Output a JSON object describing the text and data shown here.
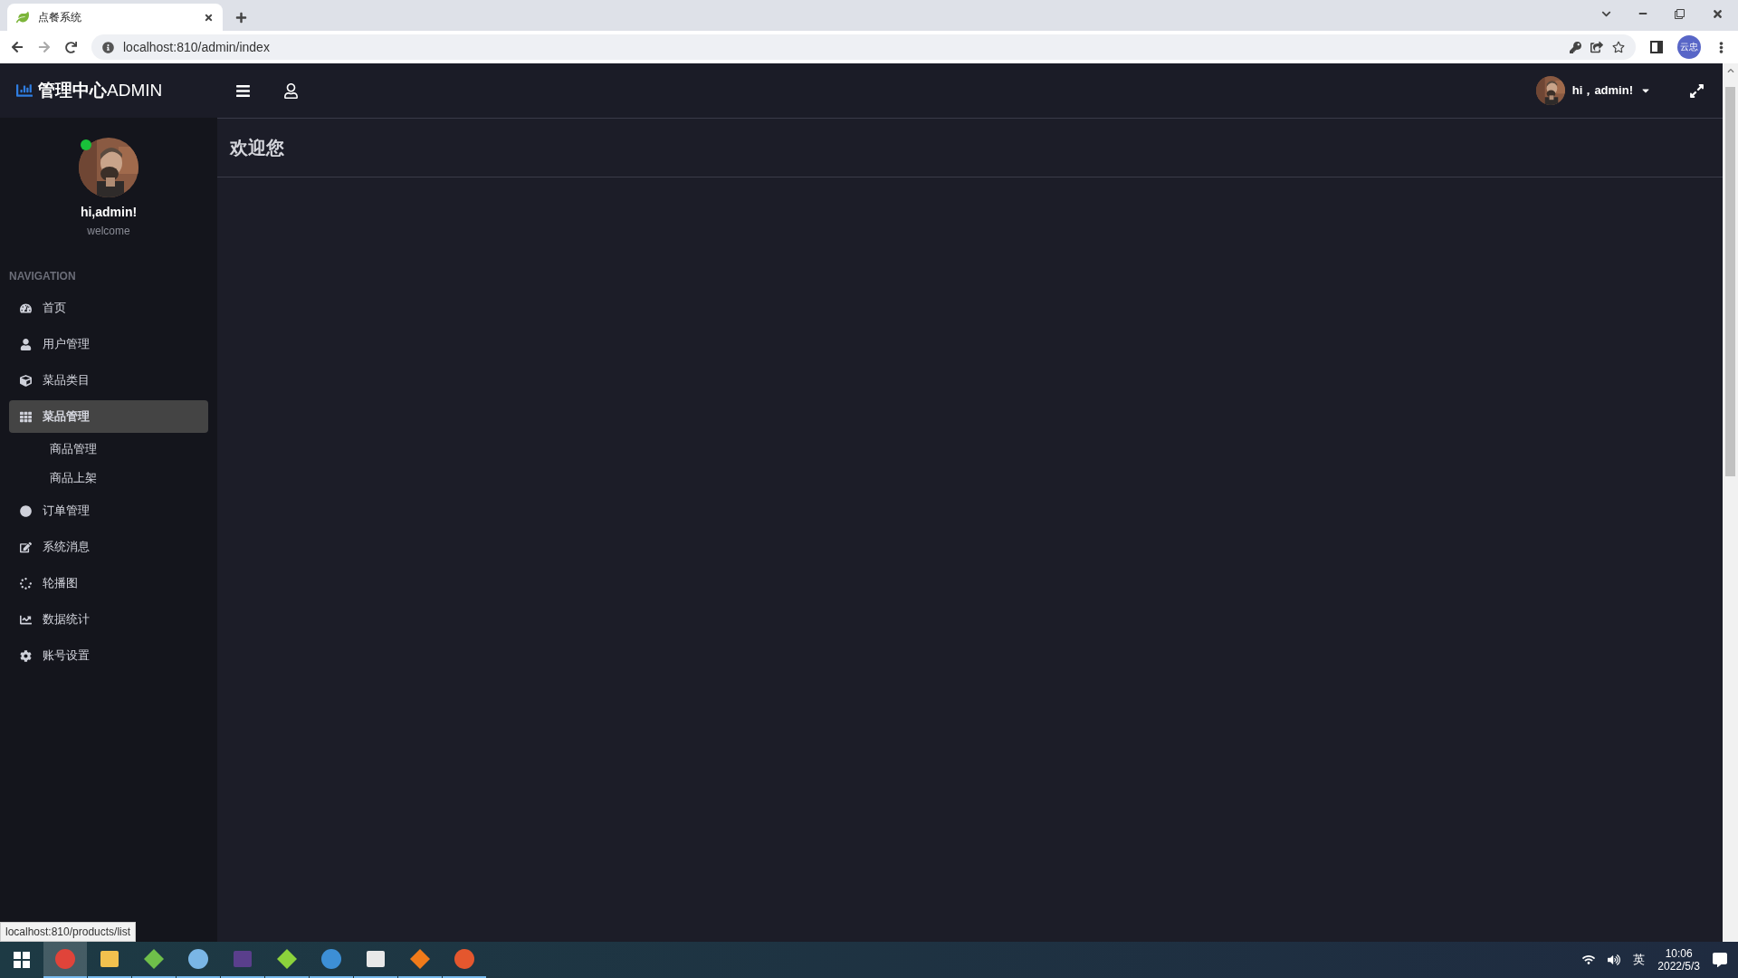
{
  "browser": {
    "tab_title": "点餐系统",
    "url": "localhost:810/admin/index",
    "profile_badge": "云忠",
    "status_url": "localhost:810/products/list"
  },
  "header": {
    "brand_bold": "管理中心",
    "brand_rest": "ADMIN",
    "user_menu": "hi，admin!"
  },
  "profile": {
    "name": "hi,admin!",
    "subtitle": "welcome",
    "online": true
  },
  "navigation": {
    "heading": "NAVIGATION",
    "items": [
      {
        "label": "首页",
        "selected": false
      },
      {
        "label": "用户管理",
        "selected": false
      },
      {
        "label": "菜品类目",
        "selected": false
      },
      {
        "label": "菜品管理",
        "selected": true,
        "expanded": true,
        "children": [
          {
            "label": "商品管理",
            "selected": false
          },
          {
            "label": "商品上架",
            "selected": false
          }
        ]
      },
      {
        "label": "订单管理",
        "selected": false
      },
      {
        "label": "系统消息",
        "selected": false
      },
      {
        "label": "轮播图",
        "selected": false
      },
      {
        "label": "数据统计",
        "selected": false
      },
      {
        "label": "账号设置",
        "selected": false
      }
    ]
  },
  "page": {
    "title": "欢迎您"
  },
  "taskbar": {
    "apps": [
      {
        "selected": true,
        "color": "#e0443a"
      },
      {
        "selected": false,
        "color": "#f2c14e"
      },
      {
        "selected": false,
        "color": "#6fbf4a"
      },
      {
        "selected": false,
        "color": "#7ab6e6"
      },
      {
        "selected": false,
        "color": "#5a3f8c"
      },
      {
        "selected": false,
        "color": "#8cd23c"
      },
      {
        "selected": false,
        "color": "#3d8fd6"
      },
      {
        "selected": false,
        "color": "#e8e8e8"
      },
      {
        "selected": false,
        "color": "#f07a1a"
      },
      {
        "selected": false,
        "color": "#e4572e"
      }
    ],
    "ime": "英",
    "time": "10:06",
    "date": "2022/5/3"
  }
}
